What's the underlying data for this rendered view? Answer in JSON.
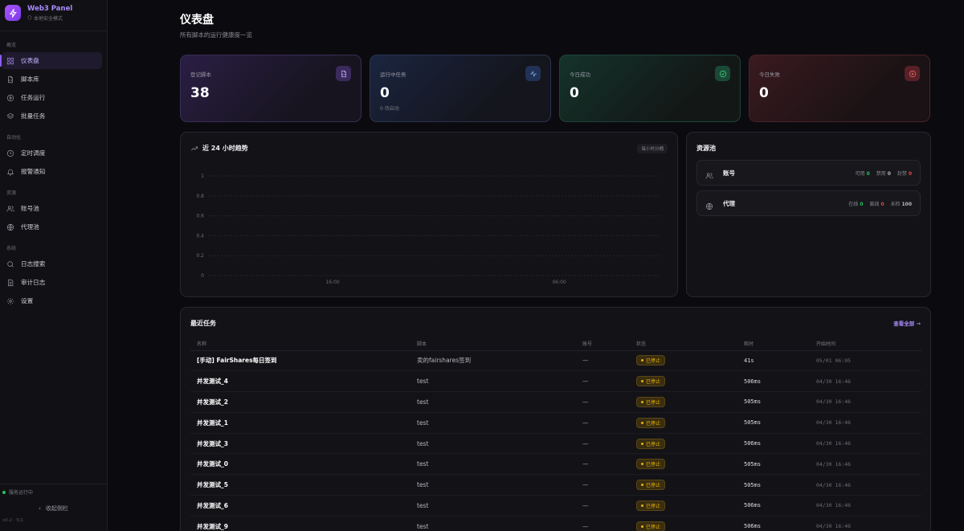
{
  "brand": {
    "title": "Web3 Panel",
    "subtitle": "本地安全模式"
  },
  "sidebar": {
    "sections": [
      {
        "title": "概览",
        "items": [
          {
            "label": "仪表盘",
            "icon": "dashboard-icon",
            "active": true
          },
          {
            "label": "脚本库",
            "icon": "script-file-icon"
          },
          {
            "label": "任务运行",
            "icon": "play-circle-icon"
          },
          {
            "label": "批量任务",
            "icon": "layers-icon"
          }
        ]
      },
      {
        "title": "自动化",
        "items": [
          {
            "label": "定时调度",
            "icon": "clock-icon"
          },
          {
            "label": "报警通知",
            "icon": "bell-icon"
          }
        ]
      },
      {
        "title": "资源",
        "items": [
          {
            "label": "账号池",
            "icon": "users-icon"
          },
          {
            "label": "代理池",
            "icon": "globe-icon"
          }
        ]
      },
      {
        "title": "系统",
        "items": [
          {
            "label": "日志搜索",
            "icon": "search-icon"
          },
          {
            "label": "审计日志",
            "icon": "audit-log-icon"
          },
          {
            "label": "设置",
            "icon": "gear-icon"
          }
        ]
      }
    ],
    "service_status": "服务运行中",
    "collapse_label": "收起侧栏",
    "version": "v0.2 · 5/1"
  },
  "page": {
    "title": "仪表盘",
    "subtitle": "所有脚本的运行健康度一览"
  },
  "stats": [
    {
      "label": "登记脚本",
      "value": "38",
      "note": "",
      "icon": "file-icon"
    },
    {
      "label": "运行中任务",
      "value": "0",
      "note": "0 待启动",
      "icon": "activity-icon"
    },
    {
      "label": "今日成功",
      "value": "0",
      "note": "",
      "icon": "check-circle-icon"
    },
    {
      "label": "今日失败",
      "value": "0",
      "note": "",
      "icon": "x-circle-icon"
    }
  ],
  "trend": {
    "title": "近 24 小时趋势",
    "badge": "每小时分桶",
    "icon": "trending-up-icon"
  },
  "chart_data": {
    "type": "line",
    "title": "近 24 小时趋势",
    "y_ticks": [
      "0",
      "0.2",
      "0.4",
      "0.6",
      "0.8",
      "1"
    ],
    "x_ticks": [
      "16:00",
      "06:00"
    ],
    "ylim": [
      0,
      1
    ],
    "grid": true,
    "series": []
  },
  "pool": {
    "title": "资源池",
    "rows": [
      {
        "name": "账号",
        "icon": "users-icon",
        "stats": [
          {
            "label": "可用",
            "value": "0",
            "color": "#22c55e"
          },
          {
            "label": "禁用",
            "value": "0",
            "color": "#bbbbbb"
          },
          {
            "label": "封禁",
            "value": "0",
            "color": "#ef4444"
          }
        ]
      },
      {
        "name": "代理",
        "icon": "globe-icon",
        "stats": [
          {
            "label": "在线",
            "value": "0",
            "color": "#22c55e"
          },
          {
            "label": "离线",
            "value": "0",
            "color": "#ef4444"
          },
          {
            "label": "未检",
            "value": "100",
            "color": "#bbbbbb"
          }
        ]
      }
    ]
  },
  "recent": {
    "title": "最近任务",
    "view_all": "查看全部",
    "columns": [
      "名称",
      "脚本",
      "账号",
      "状态",
      "耗时",
      "开始时间"
    ],
    "rows": [
      {
        "name": "[手动] FairShares每日签到",
        "script": "卖的fairshares签到",
        "account": "—",
        "status": "已停止",
        "duration": "41s",
        "start": "05/01 06:05"
      },
      {
        "name": "并发测试_4",
        "script": "test",
        "account": "—",
        "status": "已停止",
        "duration": "506ms",
        "start": "04/30 16:46"
      },
      {
        "name": "并发测试_2",
        "script": "test",
        "account": "—",
        "status": "已停止",
        "duration": "505ms",
        "start": "04/30 16:46"
      },
      {
        "name": "并发测试_1",
        "script": "test",
        "account": "—",
        "status": "已停止",
        "duration": "505ms",
        "start": "04/30 16:46"
      },
      {
        "name": "并发测试_3",
        "script": "test",
        "account": "—",
        "status": "已停止",
        "duration": "506ms",
        "start": "04/30 16:46"
      },
      {
        "name": "并发测试_0",
        "script": "test",
        "account": "—",
        "status": "已停止",
        "duration": "505ms",
        "start": "04/30 16:46"
      },
      {
        "name": "并发测试_5",
        "script": "test",
        "account": "—",
        "status": "已停止",
        "duration": "505ms",
        "start": "04/30 16:46"
      },
      {
        "name": "并发测试_6",
        "script": "test",
        "account": "—",
        "status": "已停止",
        "duration": "506ms",
        "start": "04/30 16:46"
      },
      {
        "name": "并发测试_9",
        "script": "test",
        "account": "—",
        "status": "已停止",
        "duration": "506ms",
        "start": "04/30 16:46"
      }
    ]
  }
}
